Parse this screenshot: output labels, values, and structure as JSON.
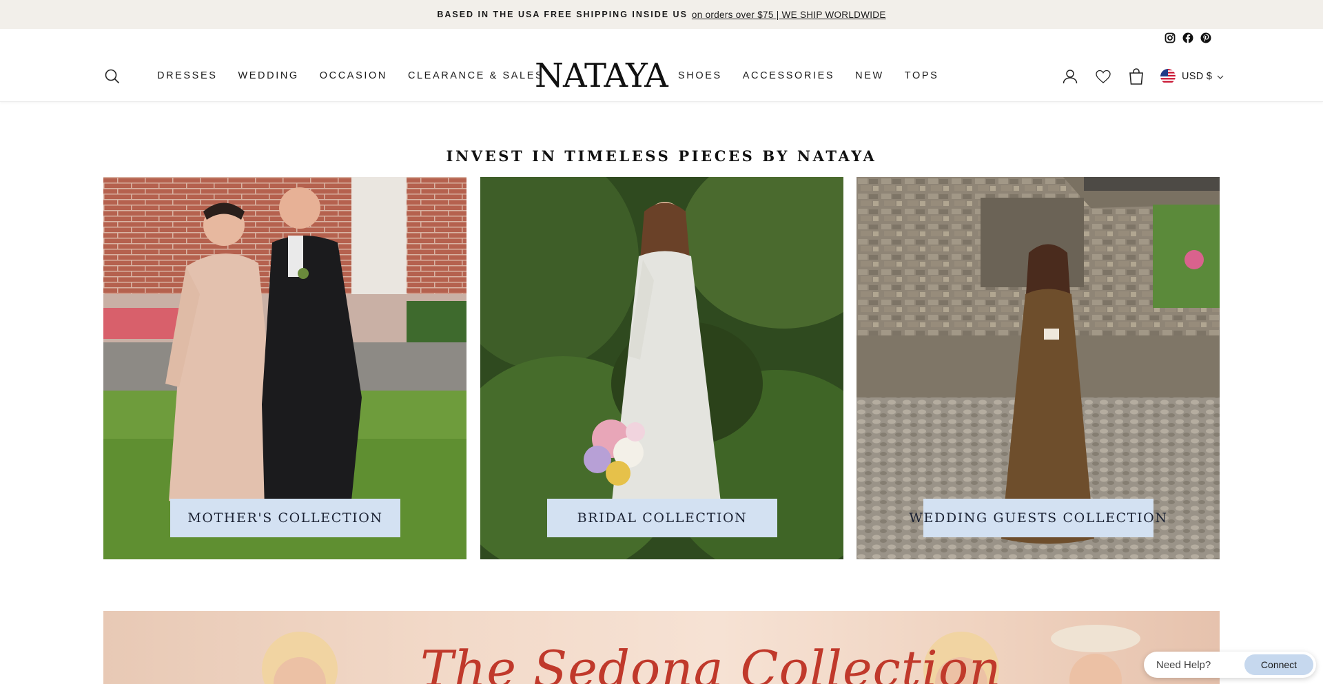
{
  "announcement": {
    "lead": "BASED IN THE USA FREE SHIPPING INSIDE US",
    "link": "on orders over $75 | WE SHIP WORLDWIDE"
  },
  "social": {
    "icons": [
      "instagram-icon",
      "facebook-icon",
      "pinterest-icon"
    ]
  },
  "nav": {
    "logo": "NATAYA",
    "left": [
      "DRESSES",
      "WEDDING",
      "OCCASION",
      "CLEARANCE & SALES"
    ],
    "right": [
      "SHOES",
      "ACCESSORIES",
      "NEW",
      "TOPS"
    ]
  },
  "header_icons": [
    "search-icon",
    "account-icon",
    "wishlist-heart-icon",
    "cart-bag-icon"
  ],
  "currency": {
    "label": "USD $",
    "flag": "us-flag-icon"
  },
  "section": {
    "title": "INVEST IN TIMELESS PIECES BY NATAYA"
  },
  "collections": [
    {
      "label": "MOTHER'S COLLECTION"
    },
    {
      "label": "BRIDAL COLLECTION"
    },
    {
      "label": "WEDDING GUESTS COLLECTION"
    }
  ],
  "banner": {
    "title": "The Sedona Collection"
  },
  "help_widget": {
    "text": "Need Help?",
    "button": "Connect"
  },
  "colors": {
    "announcement_bg": "#f2efea",
    "label_box_bg": "#d3e1f2",
    "banner_script": "#c0392b",
    "connect_btn": "#c6d8ee"
  }
}
